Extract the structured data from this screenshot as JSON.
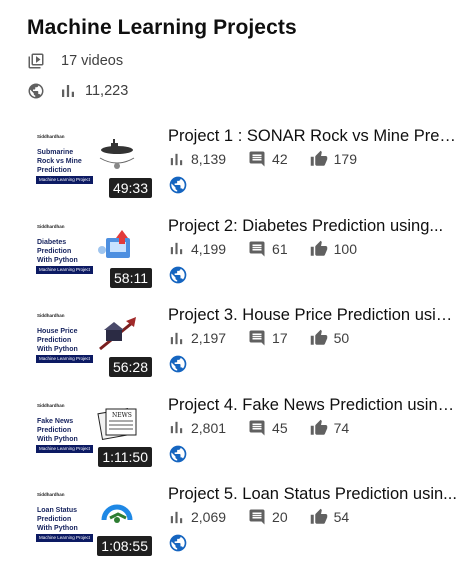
{
  "playlist": {
    "title": "Machine Learning Projects",
    "video_count": "17 videos",
    "total_views": "11,223"
  },
  "colors": {
    "badge_bg": "#0c1a63",
    "text_dark": "#0f0f0f",
    "icon_gray": "#606060",
    "globe_blue": "#1565c0"
  },
  "videos": [
    {
      "title": "Project 1 : SONAR Rock vs Mine Predi...",
      "duration": "49:33",
      "views": "8,139",
      "comments": "42",
      "likes": "179",
      "thumb": {
        "author": "Siddhardhan",
        "lines": [
          "Submarine",
          "Rock vs Mine",
          "Prediction"
        ],
        "badge": "Machine Learning Project",
        "art": "submarine-icon"
      }
    },
    {
      "title": "Project 2: Diabetes Prediction using...",
      "duration": "58:11",
      "views": "4,199",
      "comments": "61",
      "likes": "100",
      "thumb": {
        "author": "Siddhardhan",
        "lines": [
          "Diabetes",
          "Prediction",
          "With Python"
        ],
        "badge": "Machine Learning Project",
        "art": "diabetes-icon"
      }
    },
    {
      "title": "Project 3. House Price Prediction usin...",
      "duration": "56:28",
      "views": "2,197",
      "comments": "17",
      "likes": "50",
      "thumb": {
        "author": "Siddhardhan",
        "lines": [
          "House Price",
          "Prediction",
          "With Python"
        ],
        "badge": "Machine Learning Project",
        "art": "house-price-icon"
      }
    },
    {
      "title": "Project 4. Fake News Prediction using...",
      "duration": "1:11:50",
      "views": "2,801",
      "comments": "45",
      "likes": "74",
      "thumb": {
        "author": "Siddhardhan",
        "lines": [
          "Fake News",
          "Prediction",
          "With Python"
        ],
        "badge": "Machine Learning Project",
        "art": "newspaper-icon"
      }
    },
    {
      "title": "Project 5. Loan Status Prediction usin...",
      "duration": "1:08:55",
      "views": "2,069",
      "comments": "20",
      "likes": "54",
      "thumb": {
        "author": "Siddhardhan",
        "lines": [
          "Loan Status",
          "Prediction",
          "With Python"
        ],
        "badge": "Machine Learning Project",
        "art": "loan-icon"
      }
    }
  ]
}
